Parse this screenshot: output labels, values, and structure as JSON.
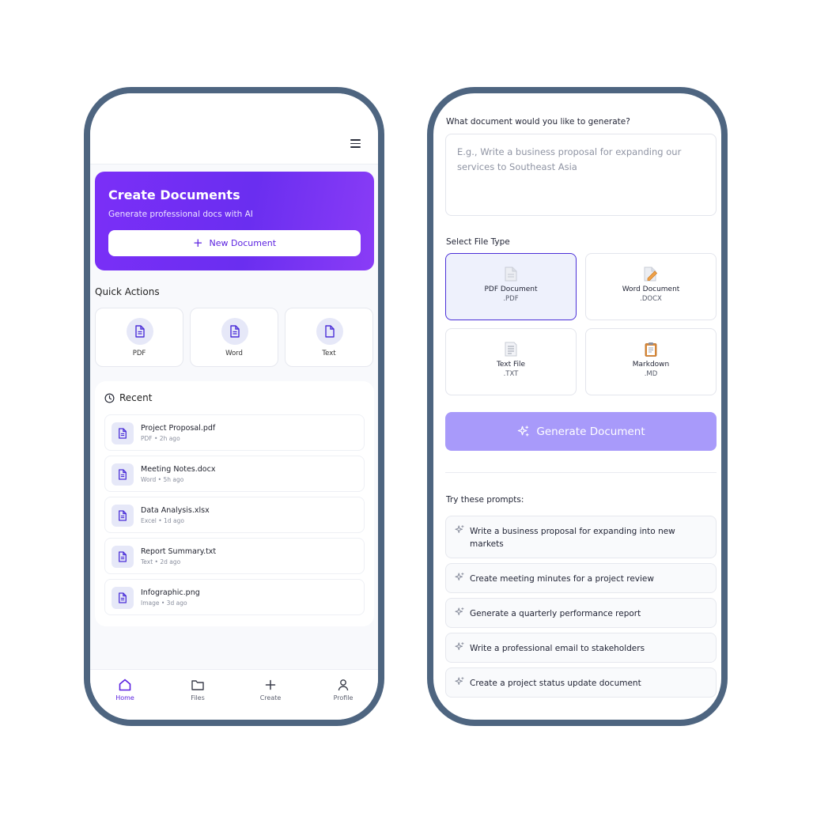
{
  "home": {
    "hero": {
      "title": "Create Documents",
      "subtitle": "Generate professional docs with AI",
      "new_button_icon": "+",
      "new_button_label": "New Document"
    },
    "quick_actions": {
      "title": "Quick Actions",
      "items": [
        {
          "label": "PDF",
          "icon": "document-icon"
        },
        {
          "label": "Word",
          "icon": "document-icon"
        },
        {
          "label": "Text",
          "icon": "file-icon"
        }
      ]
    },
    "recent": {
      "title": "Recent",
      "items": [
        {
          "name": "Project Proposal.pdf",
          "meta": "PDF • 2h ago"
        },
        {
          "name": "Meeting Notes.docx",
          "meta": "Word • 5h ago"
        },
        {
          "name": "Data Analysis.xlsx",
          "meta": "Excel • 1d ago"
        },
        {
          "name": "Report Summary.txt",
          "meta": "Text • 2d ago"
        },
        {
          "name": "Infographic.png",
          "meta": "Image • 3d ago"
        }
      ]
    },
    "nav": [
      {
        "label": "Home",
        "active": true
      },
      {
        "label": "Files",
        "active": false
      },
      {
        "label": "Create",
        "active": false
      },
      {
        "label": "Profile",
        "active": false
      }
    ]
  },
  "generate": {
    "question": "What document would you like to generate?",
    "prompt_placeholder": "E.g., Write a business proposal for expanding our services to Southeast Asia",
    "prompt_value": "",
    "file_type_label": "Select File Type",
    "file_types": [
      {
        "name": "PDF Document",
        "ext": ".PDF",
        "selected": true
      },
      {
        "name": "Word Document",
        "ext": ".DOCX",
        "selected": false
      },
      {
        "name": "Text File",
        "ext": ".TXT",
        "selected": false
      },
      {
        "name": "Markdown",
        "ext": ".MD",
        "selected": false
      }
    ],
    "generate_label": "Generate Document",
    "suggestions_title": "Try these prompts:",
    "suggestions": [
      "Write a business proposal for expanding into new markets",
      "Create meeting minutes for a project review",
      "Generate a quarterly performance report",
      "Write a professional email to stakeholders",
      "Create a project status update document"
    ]
  },
  "colors": {
    "accent": "#5b21e0",
    "hero_gradient_start": "#7b2ff7",
    "generate_button": "#a89afa",
    "frame": "#4e6580"
  }
}
